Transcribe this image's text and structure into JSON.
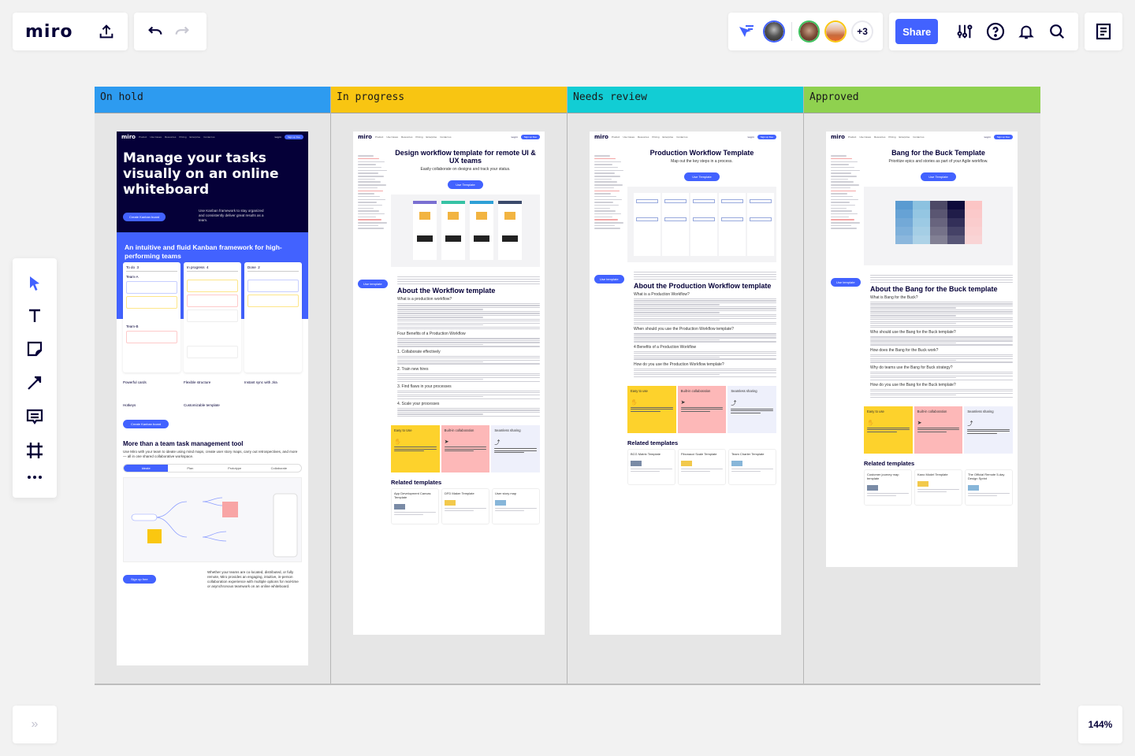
{
  "app": {
    "logo": "miro"
  },
  "toolbar_top": {
    "undo": "undo-icon",
    "redo": "redo-icon",
    "export": "upload-icon"
  },
  "collaborators": {
    "extra_count": "+3",
    "avatar_colors": [
      "#4262ff",
      "#3fc35f",
      "#fac710"
    ]
  },
  "top_actions": {
    "share_label": "Share",
    "icons": [
      "settings-sliders-icon",
      "help-icon",
      "bell-icon",
      "search-icon"
    ]
  },
  "left_tools": [
    "select-icon",
    "text-icon",
    "sticky-note-icon",
    "arrow-line-icon",
    "comment-icon",
    "frame-icon",
    "more-icon"
  ],
  "bottom": {
    "expand": "»",
    "zoom_level": "144%"
  },
  "board": {
    "columns": [
      {
        "title": "On hold",
        "color": "#2d9bf0",
        "card": {
          "nav": [
            "Product",
            "Use Cases",
            "Resources",
            "Pricing",
            "Enterprise",
            "Contact us"
          ],
          "login": "Log in",
          "signup": "Sign up free",
          "hero_title": "Manage your tasks visually on an online whiteboard",
          "hero_cta": "Create Kanban board",
          "hero_desc": "Use Kanban framework to stay organized and consistently deliver great results as a team.",
          "band_title": "An intuitive and fluid Kanban framework for high-performing teams",
          "kanban_cols": [
            {
              "label": "To do",
              "count": "3"
            },
            {
              "label": "In progress",
              "count": "4"
            },
            {
              "label": "Done",
              "count": "2"
            }
          ],
          "teams": [
            "Team-A",
            "Team-B"
          ],
          "features": [
            "Powerful cards",
            "Flexible structure",
            "Instant sync with Jira",
            "Hotkeys",
            "Customizable template"
          ],
          "cta2": "Create Kanban board",
          "section_title": "More than a team task management tool",
          "section_desc": "Use Miro with your team to ideate using mind maps, create user story maps, carry out retrospectives, and more — all in one shared collaborative workspace.",
          "tabs": [
            "Ideate",
            "Plan",
            "Prototype",
            "Collaborate"
          ],
          "signup_cta": "Sign up free",
          "closing": "Whether your teams are co-located, distributed, or fully remote, Miro provides an engaging, intuitive, in-person collaboration experience with multiple options for real-time or asynchronous teamwork on an online whiteboard."
        }
      },
      {
        "title": "In progress",
        "color": "#f8c512",
        "card": {
          "title": "Design workflow template for remote UI & UX teams",
          "subtitle": "Easily collaborate on designs and track your status.",
          "cta": "Use Template",
          "cta2": "Use template",
          "about": "About the Workflow template",
          "sections": [
            "What is a production workflow?",
            "Four Benefits of a Production Workflow",
            "1. Collaborate effectively",
            "2. Train new hires",
            "3. Find flaws in your processes",
            "4. Scale your processes"
          ],
          "features": [
            "Easy to Use",
            "Built-in collaboration",
            "Seamless sharing"
          ],
          "related_title": "Related templates",
          "related": [
            "App Development Canvas Template",
            "DFD Maker Template",
            "User story map"
          ]
        }
      },
      {
        "title": "Needs review",
        "color": "#12cdd4",
        "card": {
          "title": "Production Workflow Template",
          "subtitle": "Map out the key steps in a process.",
          "cta": "Use Template",
          "cta2": "Use template",
          "about": "About the Production Workflow template",
          "sections": [
            "What is a Production Workflow?",
            "When should you use the Production Workflow template?",
            "4 Benefits of a Production Workflow",
            "How do you use the Production Workflow template?"
          ],
          "features": [
            "Easy to use",
            "Built-in collaboration",
            "Seamless sharing"
          ],
          "related_title": "Related templates",
          "related": [
            "BCG Matrix Template",
            "Fibonacci Scale Template",
            "Team Charter Template"
          ]
        }
      },
      {
        "title": "Approved",
        "color": "#8fd14f",
        "card": {
          "title": "Bang for the Buck Template",
          "subtitle": "Prioritize epics and stories as part of your Agile workflow.",
          "cta": "Use Template",
          "cta2": "Use template",
          "about": "About the Bang for the Buck template",
          "sections": [
            "What is Bang for the Buck?",
            "Who should use the Bang for the Buck template?",
            "How does the Bang for the Buck work?",
            "Why do teams use the Bang for Buck strategy?",
            "How do you use the Bang for the Buck template?"
          ],
          "features": [
            "Easy to use",
            "Built-in collaboration",
            "Seamless sharing"
          ],
          "related_title": "Related templates",
          "related": [
            "Customer journey map template",
            "Kano Model Template",
            "The Official Remote 5-day Design Sprint"
          ]
        }
      }
    ]
  }
}
